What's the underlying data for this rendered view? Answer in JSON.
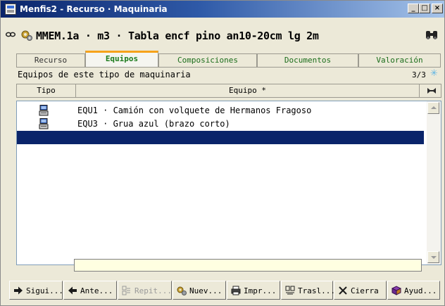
{
  "window": {
    "title": "Menfis2 - Recurso · Maquinaria",
    "minimize_label": "_",
    "maximize_label": "□",
    "close_label": "×"
  },
  "header": {
    "record_title": "MMEM.1a · m3 · Tabla encf  pino an10-20cm lg 2m"
  },
  "tabs": [
    {
      "label": "Recurso",
      "active": false
    },
    {
      "label": "Equipos",
      "active": true
    },
    {
      "label": "Composiciones",
      "active": false
    },
    {
      "label": "Documentos",
      "active": false
    },
    {
      "label": "Valoración",
      "active": false
    }
  ],
  "panel": {
    "title": "Equipos de este tipo de maquinaria",
    "counter": "3/3"
  },
  "grid": {
    "columns": [
      "Tipo",
      "Equipo *"
    ],
    "rows": [
      {
        "tipo_icon": "computer-icon",
        "equipo": "EQU1 · Camión con volquete de Hermanos Fragoso"
      },
      {
        "tipo_icon": "computer-icon",
        "equipo": "EQU3 · Grua azul (brazo corto)"
      },
      {
        "tipo_icon": "",
        "equipo": ""
      }
    ],
    "selected_row": 3,
    "selection_color": "#0a246a"
  },
  "edit_field": {
    "value": ""
  },
  "toolbar": {
    "buttons": [
      {
        "label": "Sigui...",
        "icon": "arrow-right-icon"
      },
      {
        "label": "Ante...",
        "icon": "arrow-left-icon"
      },
      {
        "label": "Repit...",
        "icon": "repeat-icon",
        "disabled": true
      },
      {
        "label": "Nuev...",
        "icon": "gears-new-icon"
      },
      {
        "label": "Impr...",
        "icon": "printer-icon"
      },
      {
        "label": "Trasl...",
        "icon": "transfer-icon"
      },
      {
        "label": "Cierra",
        "icon": "close-x-icon"
      },
      {
        "label": "Ayud...",
        "icon": "help-book-icon"
      }
    ]
  },
  "colors": {
    "title_gradient_start": "#0a246a",
    "title_gradient_end": "#a6c4ea",
    "active_tab_accent": "#f6a21a",
    "tab_text_green": "#1b6d1b"
  }
}
